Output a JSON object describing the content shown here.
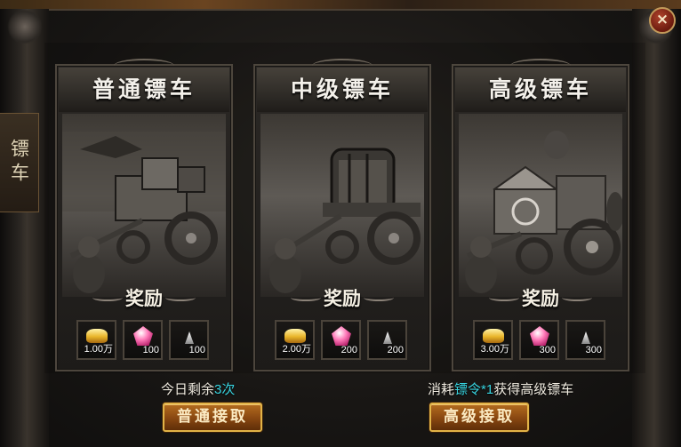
{
  "tab": {
    "label": "镖车"
  },
  "close": {
    "label": "×"
  },
  "cards": [
    {
      "title": "普通镖车",
      "reward_label": "奖励",
      "items": [
        {
          "icon": "gold-ingot-icon",
          "qty": "1.00万"
        },
        {
          "icon": "pink-gem-icon",
          "qty": "100"
        },
        {
          "icon": "silver-shard-icon",
          "qty": "100"
        }
      ]
    },
    {
      "title": "中级镖车",
      "reward_label": "奖励",
      "items": [
        {
          "icon": "gold-ingot-icon",
          "qty": "2.00万"
        },
        {
          "icon": "pink-gem-icon",
          "qty": "200"
        },
        {
          "icon": "silver-shard-icon",
          "qty": "200"
        }
      ]
    },
    {
      "title": "高级镖车",
      "reward_label": "奖励",
      "items": [
        {
          "icon": "gold-ingot-icon",
          "qty": "3.00万"
        },
        {
          "icon": "pink-gem-icon",
          "qty": "300"
        },
        {
          "icon": "silver-shard-icon",
          "qty": "300"
        }
      ]
    }
  ],
  "footer_left": {
    "prefix": "今日剩余",
    "count": "3次"
  },
  "footer_right": {
    "prefix": "消耗",
    "token": "镖令*1",
    "suffix": "获得高级镖车"
  },
  "buttons": {
    "normal": "普通接取",
    "advanced": "高级接取"
  }
}
